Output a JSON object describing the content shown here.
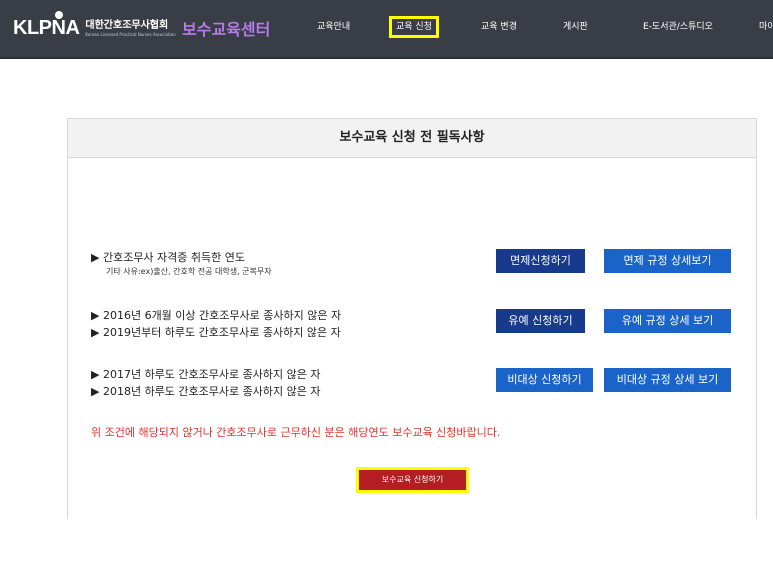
{
  "header": {
    "logo_mark": "KLPNA",
    "logo_kr": "대한간호조무사협회",
    "logo_en": "Korean Licensed Practical Nurses Association",
    "center_title": "보수교육센터",
    "nav": [
      "교육안내",
      "교육 신청",
      "교육 변경",
      "게시판",
      "E-도서관/스튜디오",
      "마이"
    ]
  },
  "panel": {
    "title": "보수교육 신청 전 필독사항",
    "groups": [
      {
        "lines": [
          "▶ 간호조무사 자격증 취득한 연도"
        ],
        "sub": "기타 사유:ex)출산, 간호학 전공 대학생, 군복무자",
        "buttons": [
          "면제신청하기",
          "면제 규정 상세보기"
        ]
      },
      {
        "lines": [
          "▶ 2016년 6개월 이상 간호조무사로 종사하지 않은 자",
          "▶ 2019년부터 하루도 간호조무사로 종사하지 않은 자"
        ],
        "buttons": [
          "유예 신청하기",
          "유예 규정 상세 보기"
        ]
      },
      {
        "lines": [
          "▶ 2017년 하루도 간호조무사로 종사하지 않은 자",
          "▶ 2018년 하루도 간호조무사로 종사하지 않은 자"
        ],
        "buttons": [
          "비대상 신청하기",
          "비대상 규정 상세 보기"
        ]
      }
    ],
    "notice": "위 조건에 해당되지 않거나 간호조무사로 근무하신 분은 해당연도 보수교육 신청바랍니다.",
    "apply_button": "보수교육 신청하기"
  },
  "colors": {
    "header_bg": "#383d46",
    "accent_purple": "#b57be8",
    "highlight_yellow": "#ffff00",
    "btn_dark_blue": "#173a8c",
    "btn_blue": "#1a63c8",
    "notice_red": "#e0312b",
    "apply_red": "#b51d22"
  }
}
